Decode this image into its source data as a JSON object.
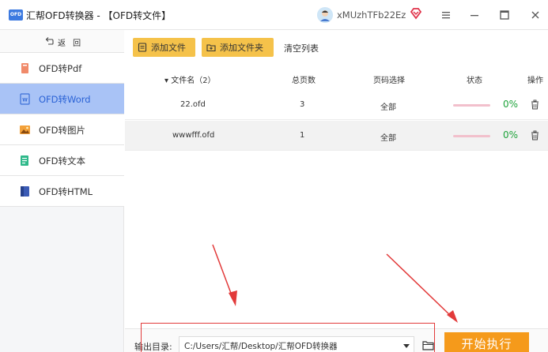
{
  "app": {
    "logo_text": "OFD",
    "title": "汇帮OFD转换器 - 【OFD转文件】",
    "user_name": "xMUzhTFb22Ez"
  },
  "sidebar": {
    "back_label": "返 回",
    "items": [
      {
        "label": "OFD转Pdf",
        "icon": "pdf-icon",
        "active": false
      },
      {
        "label": "OFD转Word",
        "icon": "word-icon",
        "active": true
      },
      {
        "label": "OFD转图片",
        "icon": "image-icon",
        "active": false
      },
      {
        "label": "OFD转文本",
        "icon": "text-icon",
        "active": false
      },
      {
        "label": "OFD转HTML",
        "icon": "html-icon",
        "active": false
      }
    ]
  },
  "toolbar": {
    "add_file": "添加文件",
    "add_folder": "添加文件夹",
    "clear_list": "清空列表"
  },
  "table": {
    "headers": {
      "filename": "▾ 文件名（2）",
      "pages": "总页数",
      "page_select": "页码选择",
      "status": "状态",
      "action": "操作"
    },
    "rows": [
      {
        "filename": "22.ofd",
        "pages": "3",
        "page_select": "全部",
        "progress_pct": "0%"
      },
      {
        "filename": "wwwfff.ofd",
        "pages": "1",
        "page_select": "全部",
        "progress_pct": "0%"
      }
    ]
  },
  "bottom": {
    "output_label": "输出目录:",
    "output_path": "C:/Users/汇帮/Desktop/汇帮OFD转换器",
    "start_button": "开始执行"
  },
  "colors": {
    "accent_yellow": "#f5c24a",
    "active_nav": "#a9c3f6",
    "start_orange": "#f59a1b",
    "progress_green": "#1fa33b",
    "annotation_red": "#e23a3a"
  }
}
